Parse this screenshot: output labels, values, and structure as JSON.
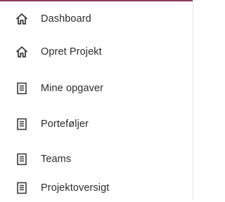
{
  "menu": {
    "items": [
      {
        "label": "Dashboard",
        "icon": "home-icon"
      },
      {
        "label": "Opret Projekt",
        "icon": "home-icon"
      },
      {
        "label": "Mine opgaver",
        "icon": "document-icon"
      },
      {
        "label": "Porteføljer",
        "icon": "document-icon"
      },
      {
        "label": "Teams",
        "icon": "document-icon"
      },
      {
        "label": "Projektoversigt",
        "icon": "document-icon"
      }
    ]
  },
  "colors": {
    "text": "#2b2b2b",
    "icon": "#3a3a3a",
    "accent_line": "#8a3b57"
  }
}
